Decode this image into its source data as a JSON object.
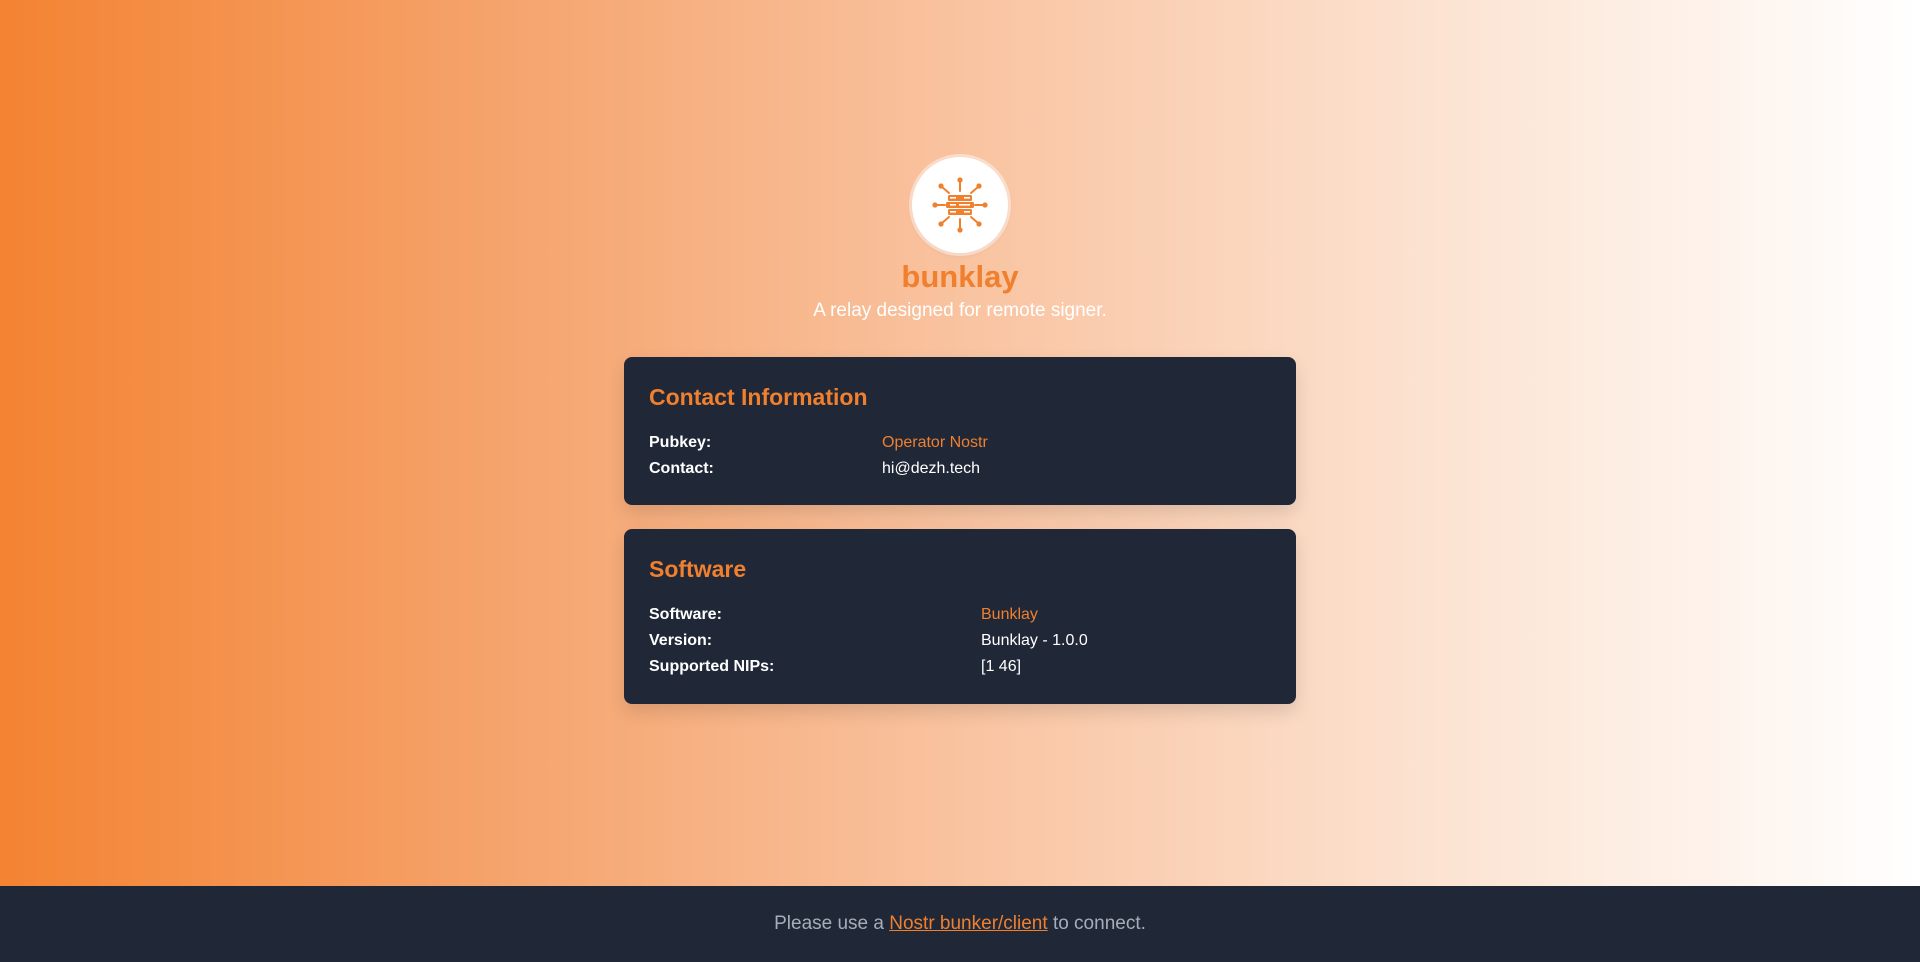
{
  "header": {
    "title": "bunklay",
    "subtitle": "A relay designed for remote signer.",
    "logo_icon": "relay-hub-icon",
    "accent_color": "#f07f2e"
  },
  "contact": {
    "title": "Contact Information",
    "pubkey_label": "Pubkey:",
    "pubkey_value": "Operator Nostr",
    "contact_label": "Contact:",
    "contact_value": "hi@dezh.tech"
  },
  "software": {
    "title": "Software",
    "software_label": "Software:",
    "software_value": "Bunklay",
    "version_label": "Version:",
    "version_value": "Bunklay - 1.0.0",
    "nips_label": "Supported NIPs:",
    "nips_value": "[1 46]"
  },
  "footer": {
    "prefix": "Please use a",
    "link_text": "Nostr bunker/client",
    "suffix": "to connect."
  },
  "colors": {
    "card_bg": "#202838",
    "footer_bg": "#202838",
    "gradient_start": "#f48332",
    "gradient_end": "#ffffff"
  }
}
